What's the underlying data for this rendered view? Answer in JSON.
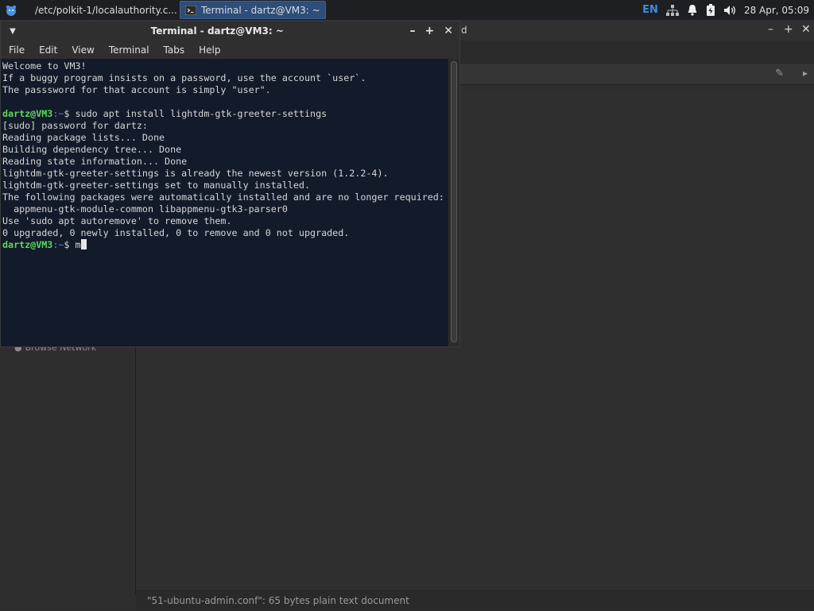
{
  "panel": {
    "tasks": [
      {
        "label": "/etc/polkit-1/localauthority.c...",
        "icon": "folder-icon"
      },
      {
        "label": "Terminal - dartz@VM3: ~",
        "icon": "terminal-icon"
      }
    ],
    "lang": "EN",
    "clock": "28 Apr, 05:09",
    "tray_icons": [
      "network-icon",
      "bell-icon",
      "battery-icon",
      "volume-icon"
    ]
  },
  "file_manager": {
    "title_fragment": "d",
    "sidebar_item": "Browse Network",
    "status": "\"51-ubuntu-admin.conf\": 65 bytes plain text document"
  },
  "terminal": {
    "title": "Terminal - dartz@VM3: ~",
    "menu": [
      "File",
      "Edit",
      "View",
      "Terminal",
      "Tabs",
      "Help"
    ],
    "prompt_user": "dartz@VM3",
    "prompt_path": ":~",
    "lines": [
      {
        "type": "text",
        "text": "Welcome to VM3!"
      },
      {
        "type": "text",
        "text": "If a buggy program insists on a password, use the account `user`."
      },
      {
        "type": "text",
        "text": "The passsword for that account is simply \"user\"."
      },
      {
        "type": "text",
        "text": ""
      },
      {
        "type": "prompt",
        "text": "$ sudo apt install lightdm-gtk-greeter-settings"
      },
      {
        "type": "text",
        "text": "[sudo] password for dartz:"
      },
      {
        "type": "text",
        "text": "Reading package lists... Done"
      },
      {
        "type": "text",
        "text": "Building dependency tree... Done"
      },
      {
        "type": "text",
        "text": "Reading state information... Done"
      },
      {
        "type": "text",
        "text": "lightdm-gtk-greeter-settings is already the newest version (1.2.2-4)."
      },
      {
        "type": "text",
        "text": "lightdm-gtk-greeter-settings set to manually installed."
      },
      {
        "type": "text",
        "text": "The following packages were automatically installed and are no longer required:"
      },
      {
        "type": "text",
        "text": "  appmenu-gtk-module-common libappmenu-gtk3-parser0"
      },
      {
        "type": "text",
        "text": "Use 'sudo apt autoremove' to remove them."
      },
      {
        "type": "text",
        "text": "0 upgraded, 0 newly installed, 0 to remove and 0 not upgraded."
      },
      {
        "type": "prompt",
        "text": "$ m",
        "cursor": true
      }
    ]
  }
}
